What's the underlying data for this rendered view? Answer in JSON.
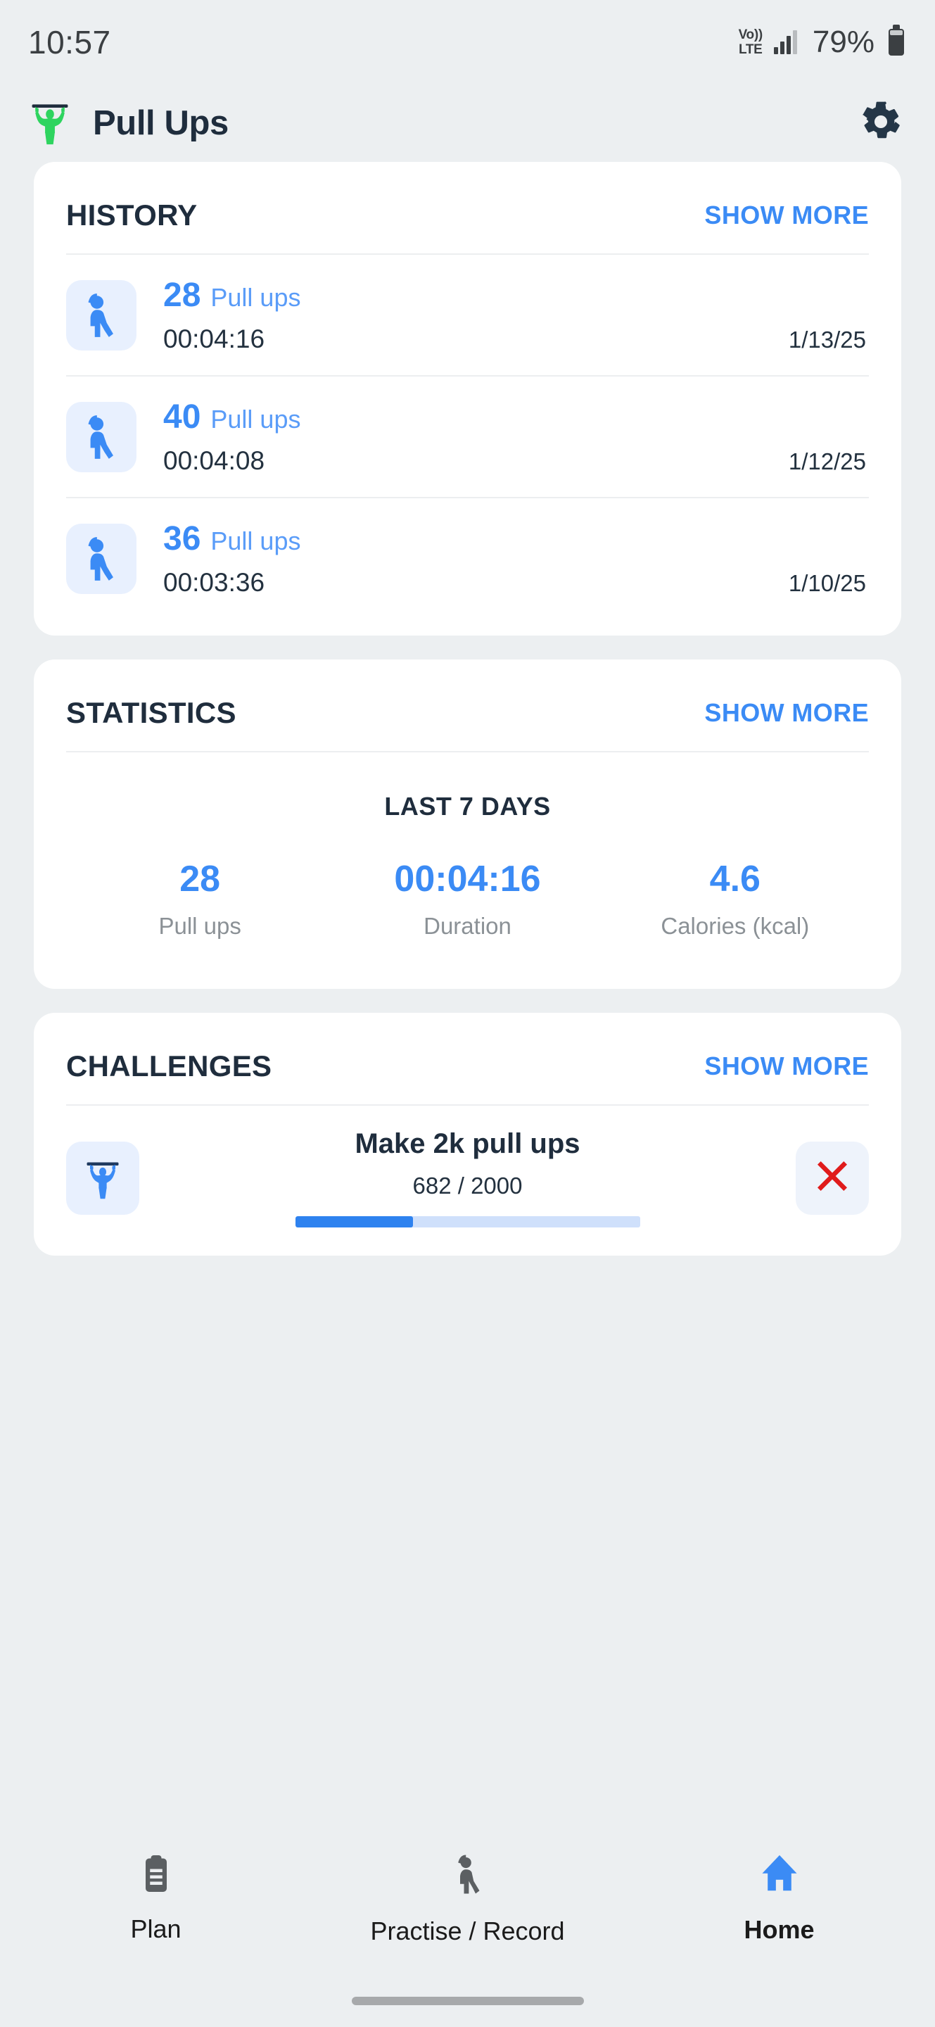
{
  "status_bar": {
    "time": "10:57",
    "volte_top": "Vo))",
    "volte_bottom": "LTE",
    "battery_percent": "79%"
  },
  "app_header": {
    "icon": "pullup-figure-icon",
    "title": "Pull Ups",
    "settings_icon": "gear-icon"
  },
  "history": {
    "title": "HISTORY",
    "show_more": "SHOW MORE",
    "rows": [
      {
        "icon": "exercise-figure-icon",
        "count": "28",
        "unit": "Pull ups",
        "duration": "00:04:16",
        "date": "1/13/25"
      },
      {
        "icon": "exercise-figure-icon",
        "count": "40",
        "unit": "Pull ups",
        "duration": "00:04:08",
        "date": "1/12/25"
      },
      {
        "icon": "exercise-figure-icon",
        "count": "36",
        "unit": "Pull ups",
        "duration": "00:03:36",
        "date": "1/10/25"
      }
    ]
  },
  "statistics": {
    "title": "STATISTICS",
    "show_more": "SHOW MORE",
    "period": "LAST 7 DAYS",
    "items": [
      {
        "value": "28",
        "label": "Pull ups"
      },
      {
        "value": "00:04:16",
        "label": "Duration"
      },
      {
        "value": "4.6",
        "label": "Calories (kcal)"
      }
    ]
  },
  "challenges": {
    "title": "CHALLENGES",
    "show_more": "SHOW MORE",
    "row": {
      "icon": "pullup-bar-icon",
      "name": "Make 2k pull ups",
      "progress_text": "682 / 2000",
      "current": 682,
      "target": 2000,
      "percent": 34.1,
      "dismiss_icon": "red-x-icon"
    }
  },
  "bottom_nav": {
    "items": [
      {
        "label": "Plan",
        "icon": "clipboard-icon",
        "active": false
      },
      {
        "label": "Practise / Record",
        "icon": "walking-figure-icon",
        "active": false
      },
      {
        "label": "Home",
        "icon": "home-icon",
        "active": true
      }
    ]
  },
  "colors": {
    "accent_blue": "#3b8bf5",
    "dark_navy": "#1f2d3d",
    "green": "#2ed45f",
    "red": "#e01b1b",
    "bg": "#eceff1"
  }
}
